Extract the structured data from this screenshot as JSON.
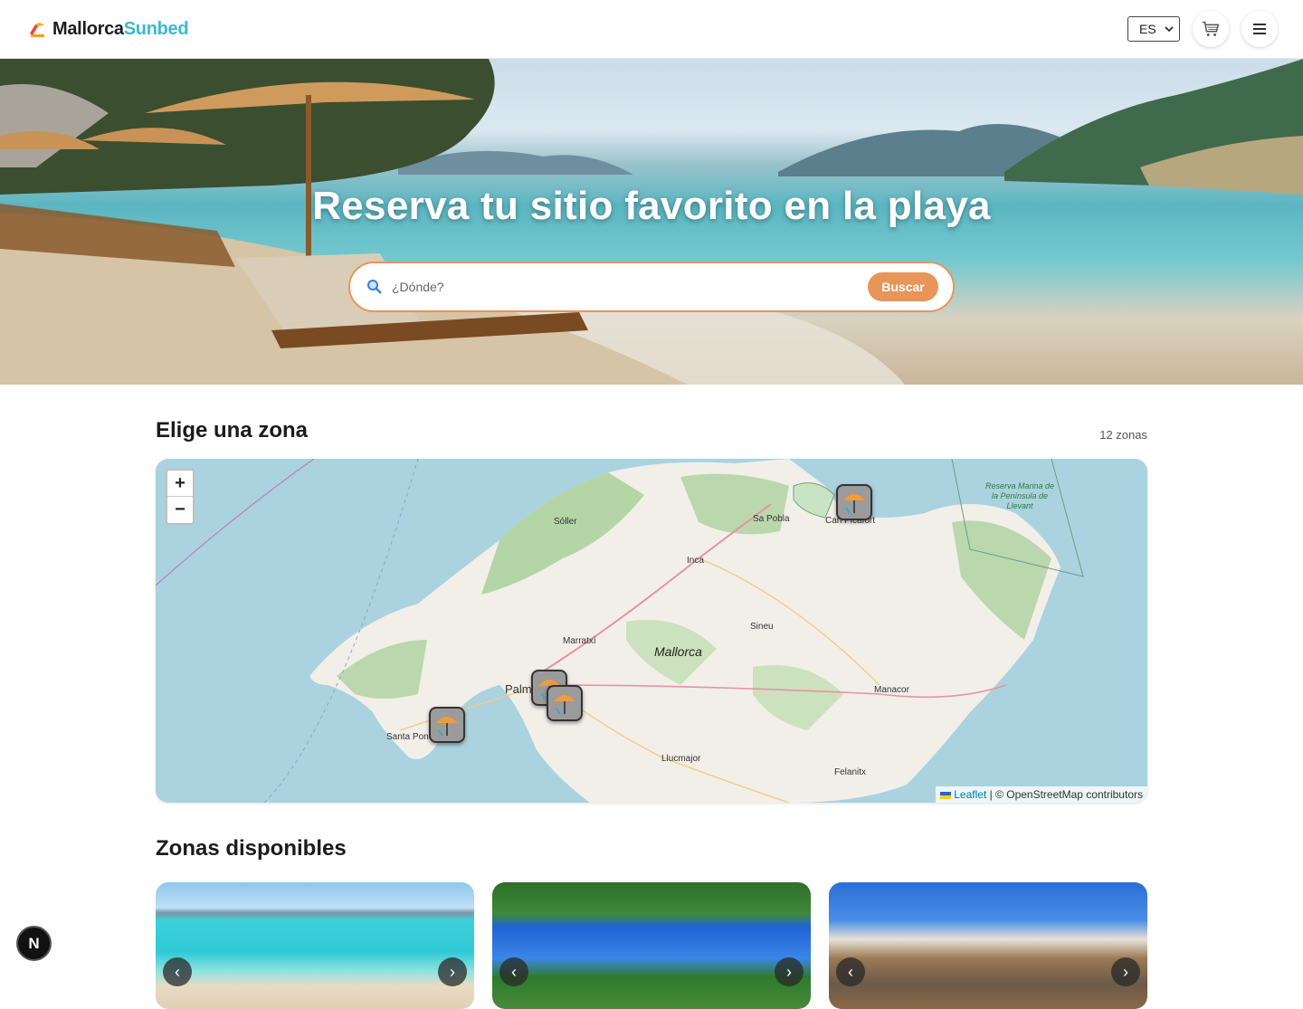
{
  "header": {
    "brand_part1": "Mallorca",
    "brand_part2": "Sunbed",
    "language": "ES",
    "icons": [
      "logo-icon",
      "cart-icon",
      "menu-icon"
    ]
  },
  "hero": {
    "title": "Reserva tu sitio favorito en la playa",
    "search_placeholder": "¿Dónde?",
    "search_button": "Buscar"
  },
  "zones_section": {
    "title": "Elige una zona",
    "count": "12 zonas"
  },
  "map": {
    "zoom_in": "+",
    "zoom_out": "−",
    "places": [
      "Sóller",
      "Sa Pobla",
      "Can Picafort",
      "Inca",
      "Sineu",
      "Marratxí",
      "Mallorca",
      "Palma",
      "Manacor",
      "Santa Ponsa",
      "Llucmajor",
      "Felanitx",
      "Reserva Marina de la Península de Llevant"
    ],
    "attribution_link": "Leaflet",
    "attribution_text": " | © OpenStreetMap contributors"
  },
  "available_section": {
    "title": "Zonas disponibles"
  },
  "colors": {
    "accent": "#e8955a",
    "brand_blue": "#3fb8cf",
    "sea": "#aad3df",
    "land": "#f2efe9"
  }
}
